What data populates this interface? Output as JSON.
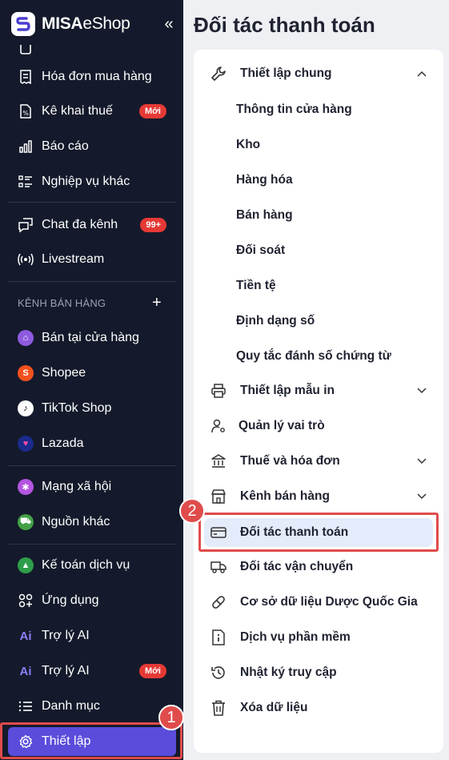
{
  "brand": {
    "bold": "MISA",
    "rest": "eShop"
  },
  "sidebar": {
    "items": [
      {
        "label": "Hóa đơn mua hàng",
        "icon": "receipt-icon"
      },
      {
        "label": "Kê khai thuế",
        "icon": "tax-doc-icon",
        "badge": "Mới"
      },
      {
        "label": "Báo cáo",
        "icon": "bar-chart-icon"
      },
      {
        "label": "Nghiệp vụ khác",
        "icon": "list-icon"
      },
      {
        "label": "Chat đa kênh",
        "icon": "chat-icon",
        "badge": "99+"
      },
      {
        "label": "Livestream",
        "icon": "livestream-icon"
      }
    ],
    "channels_label": "KÊNH BÁN HÀNG",
    "channels": [
      {
        "label": "Bán tại cửa hàng",
        "icon": "store-icon",
        "color": "#8e5bdf"
      },
      {
        "label": "Shopee",
        "icon": "shopee-icon",
        "color": "#f4511e"
      },
      {
        "label": "TikTok Shop",
        "icon": "tiktok-icon",
        "color": "#ffffff"
      },
      {
        "label": "Lazada",
        "icon": "lazada-icon",
        "color": "#1a2b8c"
      }
    ],
    "social": [
      {
        "label": "Mạng xã hội",
        "icon": "social-icon",
        "color": "#b455e0"
      },
      {
        "label": "Nguồn khác",
        "icon": "cart-icon",
        "color": "#43a047"
      }
    ],
    "bottom": [
      {
        "label": "Kế toán dịch vụ",
        "icon": "accounting-icon"
      },
      {
        "label": "Ứng dụng",
        "icon": "apps-icon"
      },
      {
        "label": "Trợ lý AI",
        "icon": "ai-icon"
      },
      {
        "label": "Trợ lý AI",
        "icon": "ai-icon",
        "badge": "Mới"
      },
      {
        "label": "Danh mục",
        "icon": "menu-list-icon"
      },
      {
        "label": "Thiết lập",
        "icon": "gear-icon",
        "active": true
      }
    ]
  },
  "main": {
    "title": "Đối tác thanh toán",
    "settings": {
      "general": {
        "label": "Thiết lập chung",
        "expanded": true,
        "children": [
          "Thông tin cửa hàng",
          "Kho",
          "Hàng hóa",
          "Bán hàng",
          "Đối soát",
          "Tiền tệ",
          "Định dạng số",
          "Quy tắc đánh số chứng từ"
        ]
      },
      "items": [
        {
          "label": "Thiết lập mẫu in",
          "icon": "printer-icon",
          "chevron": true
        },
        {
          "label": "Quản lý vai trò",
          "icon": "user-gear-icon"
        },
        {
          "label": "Thuế và hóa đơn",
          "icon": "bank-icon",
          "chevron": true
        },
        {
          "label": "Kênh bán hàng",
          "icon": "storefront-icon",
          "chevron": true
        },
        {
          "label": "Đối tác thanh toán",
          "icon": "card-icon",
          "active": true
        },
        {
          "label": "Đối tác vận chuyển",
          "icon": "truck-icon"
        },
        {
          "label": "Cơ sở dữ liệu Dược Quốc Gia",
          "icon": "pill-icon"
        },
        {
          "label": "Dịch vụ phần mềm",
          "icon": "info-doc-icon"
        },
        {
          "label": "Nhật ký truy cập",
          "icon": "history-icon"
        },
        {
          "label": "Xóa dữ liệu",
          "icon": "trash-icon"
        }
      ]
    }
  },
  "callouts": [
    "1",
    "2"
  ],
  "colors": {
    "sidebar_bg": "#141a2b",
    "active": "#5b4cdb",
    "callout": "#e04b4b",
    "active_row": "#e4ebfb"
  }
}
